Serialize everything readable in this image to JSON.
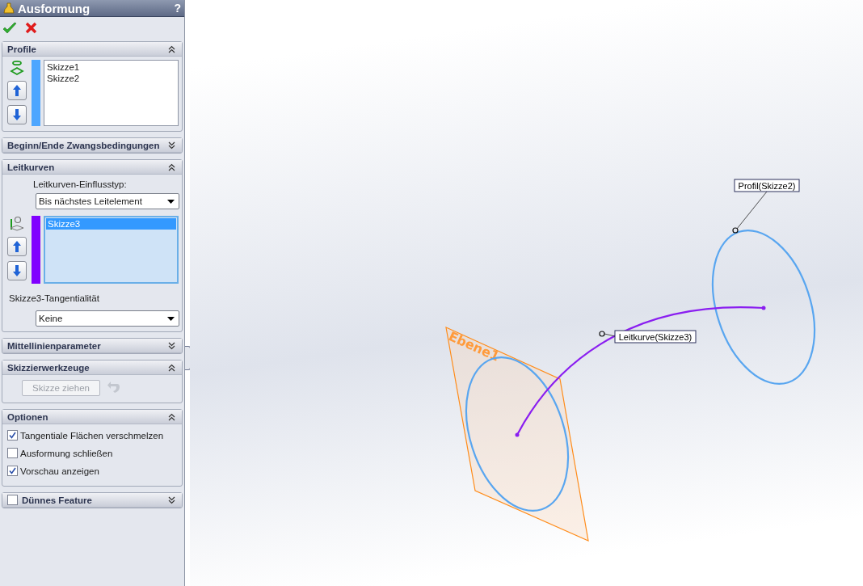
{
  "window": {
    "title": "Ausformung",
    "help": "?"
  },
  "sections": [
    {
      "kind": "profiles",
      "title": "Profile",
      "expanded": true,
      "color": "#4da6ff",
      "items": [
        {
          "label": "Skizze1",
          "selected": false
        },
        {
          "label": "Skizze2",
          "selected": false
        }
      ]
    },
    {
      "kind": "constraints",
      "title": "Beginn/Ende Zwangsbedingungen",
      "expanded": false
    },
    {
      "kind": "guides",
      "title": "Leitkurven",
      "expanded": true,
      "color": "#8000ff",
      "influence_label": "Leitkurven-Einflusstyp:",
      "influence": "Bis nächstes Leitelement",
      "items": [
        {
          "label": "Skizze3",
          "selected": true
        }
      ],
      "tangency_label": "Skizze3-Tangentialität",
      "tangency": "Keine"
    },
    {
      "kind": "centerline",
      "title": "Mittellinienparameter",
      "expanded": false
    },
    {
      "kind": "tools",
      "title": "Skizzierwerkzeuge",
      "expanded": true,
      "button": {
        "label": "Skizze ziehen",
        "disabled": true
      }
    },
    {
      "kind": "options",
      "title": "Optionen",
      "expanded": true,
      "options": [
        {
          "label": "Tangentiale Flächen verschmelzen",
          "checked": true
        },
        {
          "label": "Ausformung schließen",
          "checked": false
        },
        {
          "label": "Vorschau anzeigen",
          "checked": true
        }
      ]
    },
    {
      "kind": "thin",
      "title": "Dünnes Feature",
      "expanded": false,
      "checked": false
    }
  ],
  "canvas": {
    "plane_label": "Ebene1",
    "profile_callout": "Profil(Skizze2)",
    "guide_callout": "Leitkurve(Skizze3)"
  }
}
